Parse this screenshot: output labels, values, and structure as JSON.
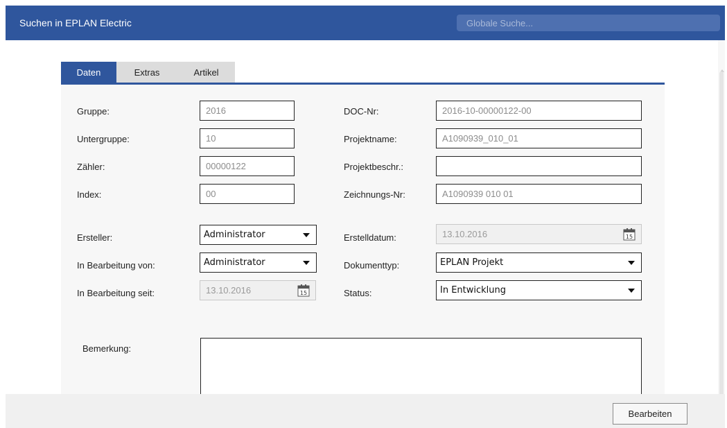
{
  "app": {
    "title": "Suchen in EPLAN Electric"
  },
  "search": {
    "placeholder": "Globale Suche..."
  },
  "tabs": [
    {
      "label": "Daten",
      "active": true
    },
    {
      "label": "Extras",
      "active": false
    },
    {
      "label": "Artikel",
      "active": false
    }
  ],
  "form": {
    "gruppe": {
      "label": "Gruppe:",
      "value": "2016"
    },
    "untergruppe": {
      "label": "Untergruppe:",
      "value": "10"
    },
    "zaehler": {
      "label": "Zähler:",
      "value": "00000122"
    },
    "index": {
      "label": "Index:",
      "value": "00"
    },
    "doc_nr": {
      "label": "DOC-Nr:",
      "value": "2016-10-00000122-00"
    },
    "projektname": {
      "label": "Projektname:",
      "value": "A1090939_010_01"
    },
    "projektbeschr": {
      "label": "Projektbeschr.:",
      "value": ""
    },
    "zeichnungs_nr": {
      "label": "Zeichnungs-Nr:",
      "value": "A1090939 010 01"
    },
    "ersteller": {
      "label": "Ersteller:",
      "value": "Administrator"
    },
    "in_bearbeitung_von": {
      "label": "In Bearbeitung von:",
      "value": "Administrator"
    },
    "in_bearbeitung_seit": {
      "label": "In Bearbeitung seit:",
      "value": "13.10.2016"
    },
    "erstelldatum": {
      "label": "Erstelldatum:",
      "value": "13.10.2016"
    },
    "dokumenttyp": {
      "label": "Dokumenttyp:",
      "value": "EPLAN Projekt"
    },
    "status": {
      "label": "Status:",
      "value": "In Entwicklung"
    },
    "bemerkung": {
      "label": "Bemerkung:",
      "value": ""
    }
  },
  "calendar_icon_day": "15",
  "footer": {
    "edit_label": "Bearbeiten"
  },
  "colors": {
    "accent": "#2f569d",
    "search_bg": "#4e70b0"
  },
  "icons": {
    "calendar": "calendar-icon",
    "dropdown": "chevron-down-icon"
  }
}
